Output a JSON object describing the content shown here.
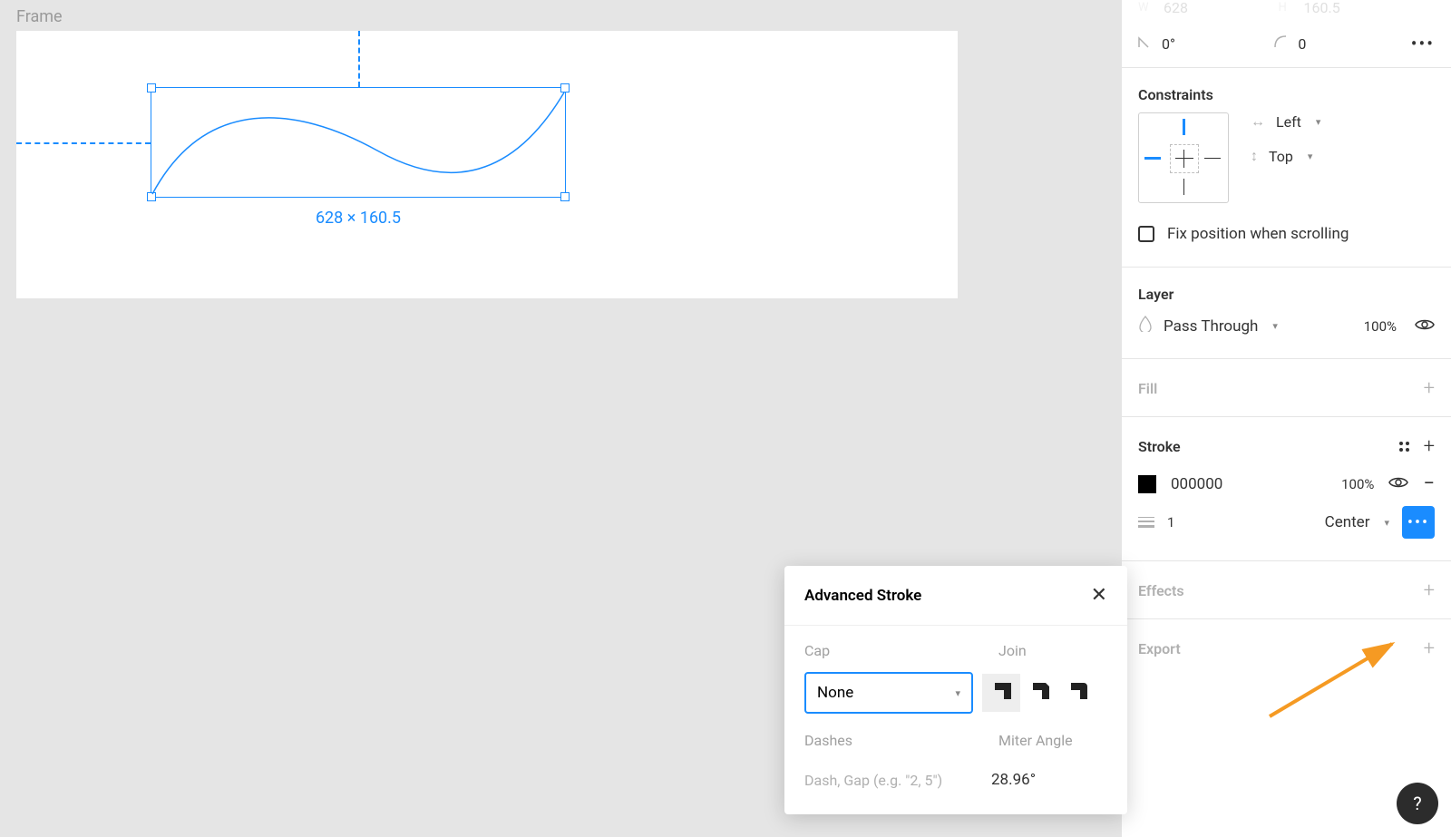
{
  "canvas": {
    "frame_label": "Frame",
    "selection_size": "628 × 160.5"
  },
  "transform": {
    "rotation": "0°",
    "corner_radius": "0",
    "corner_count": "0"
  },
  "constraints": {
    "title": "Constraints",
    "horizontal": "Left",
    "vertical": "Top",
    "fix_label": "Fix position when scrolling"
  },
  "layer": {
    "title": "Layer",
    "blend_mode": "Pass Through",
    "opacity": "100%"
  },
  "fill": {
    "title": "Fill"
  },
  "stroke": {
    "title": "Stroke",
    "color_hex": "000000",
    "opacity": "100%",
    "weight": "1",
    "align": "Center"
  },
  "effects": {
    "title": "Effects"
  },
  "export": {
    "title": "Export"
  },
  "advanced_stroke": {
    "title": "Advanced Stroke",
    "cap_label": "Cap",
    "cap_value": "None",
    "join_label": "Join",
    "dashes_label": "Dashes",
    "dashes_placeholder": "Dash, Gap (e.g. \"2, 5\")",
    "miter_label": "Miter Angle",
    "miter_value": "28.96°"
  },
  "help": "?"
}
